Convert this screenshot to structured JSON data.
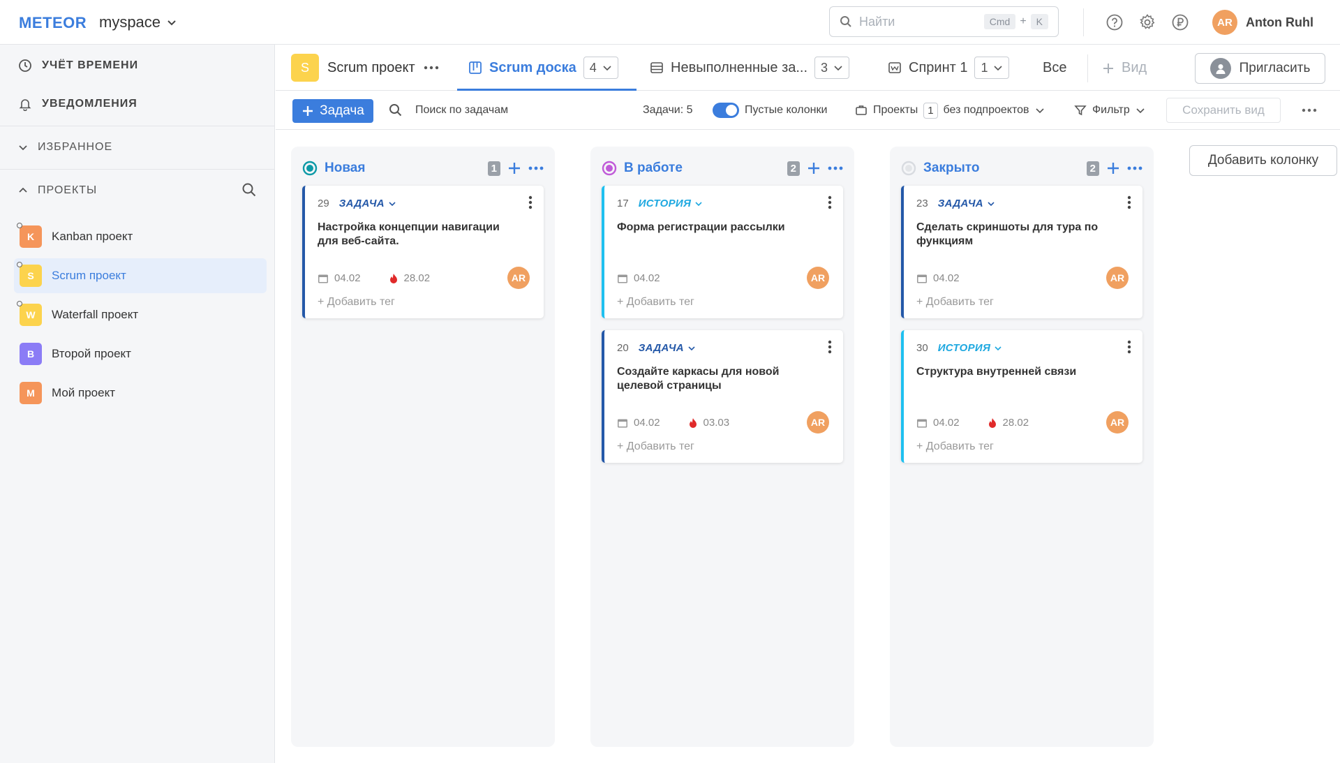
{
  "header": {
    "logo": "METEOR",
    "workspace": "myspace",
    "search_placeholder": "Найти",
    "search_key1": "Cmd",
    "search_plus": "+",
    "search_key2": "K",
    "user_initials": "AR",
    "user_name": "Anton Ruhl"
  },
  "sidebar": {
    "time_tracking": "УЧЁТ ВРЕМЕНИ",
    "notifications": "УВЕДОМЛЕНИЯ",
    "favorites": "ИЗБРАННОЕ",
    "projects": "ПРОЕКТЫ",
    "project_items": [
      {
        "letter": "K",
        "name": "Kanban проект",
        "color": "#f5955a"
      },
      {
        "letter": "S",
        "name": "Scrum проект",
        "color": "#fcd34d"
      },
      {
        "letter": "W",
        "name": "Waterfall проект",
        "color": "#fcd34d"
      },
      {
        "letter": "В",
        "name": "Второй проект",
        "color": "#8b7cf6"
      },
      {
        "letter": "М",
        "name": "Мой проект",
        "color": "#f5955a"
      }
    ]
  },
  "tabs": {
    "project_letter": "S",
    "project_name": "Scrum проект",
    "board": "Scrum доска",
    "board_count": "4",
    "backlog": "Невыполненные за...",
    "backlog_count": "3",
    "sprint": "Спринт 1",
    "sprint_count": "1",
    "all": "Все",
    "view": "Вид",
    "invite": "Пригласить"
  },
  "toolbar": {
    "add_task": "Задача",
    "search_tasks": "Поиск по задачам",
    "tasks_count": "Задачи: 5",
    "empty_columns": "Пустые колонки",
    "projects": "Проекты",
    "projects_count": "1",
    "subprojects": "без подпроектов",
    "filter": "Фильтр",
    "save_view": "Сохранить вид"
  },
  "board": {
    "add_column": "Добавить колонку",
    "add_tag": "+ Добавить тег",
    "columns": [
      {
        "title": "Новая",
        "count": "1",
        "cards": [
          {
            "num": "29",
            "type": "ЗАДАЧА",
            "title": "Настройка концепции навигации для веб-сайта.",
            "start": "04.02",
            "due": "28.02",
            "assignee": "AR"
          }
        ]
      },
      {
        "title": "В работе",
        "count": "2",
        "cards": [
          {
            "num": "17",
            "type": "ИСТОРИЯ",
            "title": "Форма регистрации рассылки",
            "start": "04.02",
            "due": "",
            "assignee": "AR"
          },
          {
            "num": "20",
            "type": "ЗАДАЧА",
            "title": "Создайте каркасы для новой целевой страницы",
            "start": "04.02",
            "due": "03.03",
            "assignee": "AR"
          }
        ]
      },
      {
        "title": "Закрыто",
        "count": "2",
        "cards": [
          {
            "num": "23",
            "type": "ЗАДАЧА",
            "title": "Сделать скриншоты для тура по функциям",
            "start": "04.02",
            "due": "",
            "assignee": "AR"
          },
          {
            "num": "30",
            "type": "ИСТОРИЯ",
            "title": "Структура внутренней связи",
            "start": "04.02",
            "due": "28.02",
            "assignee": "AR"
          }
        ]
      }
    ]
  }
}
